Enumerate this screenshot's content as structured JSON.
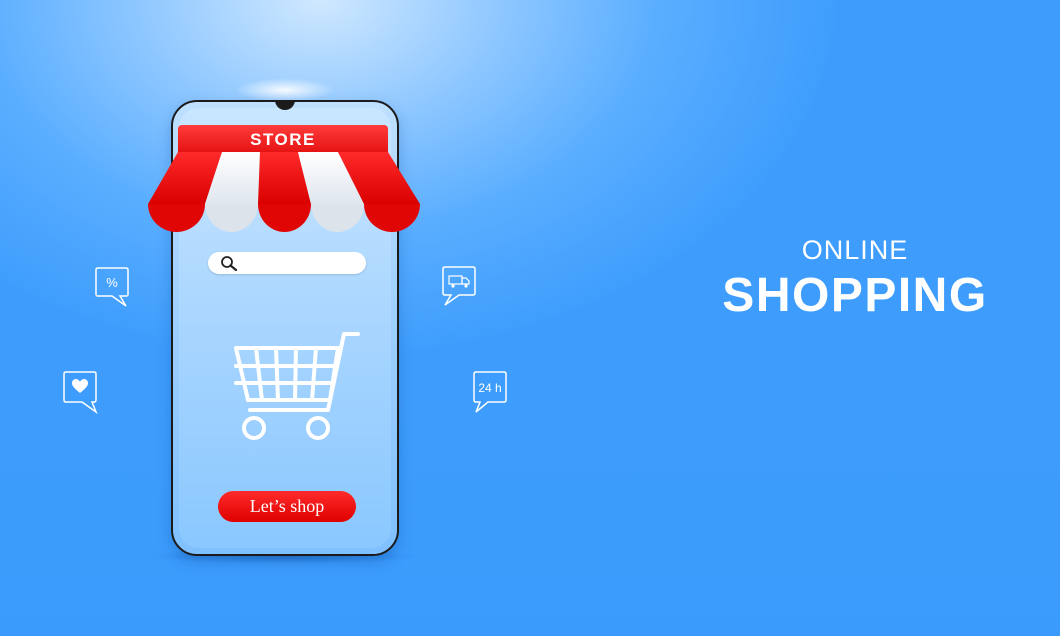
{
  "store": {
    "sign_label": "STORE"
  },
  "search": {
    "icon": "search-icon"
  },
  "cart": {
    "icon": "shopping-cart-icon"
  },
  "cta": {
    "label": "Let’s shop"
  },
  "bubbles": {
    "discount": "%",
    "hours": "24 h",
    "like": "heart-icon",
    "delivery": "truck-icon"
  },
  "headline": {
    "top": "ONLINE",
    "main": "SHOPPING"
  },
  "colors": {
    "background": "#3e9dfc",
    "awning_red": "#e31010",
    "awning_white": "#ffffff",
    "button_red": "#e00000"
  }
}
